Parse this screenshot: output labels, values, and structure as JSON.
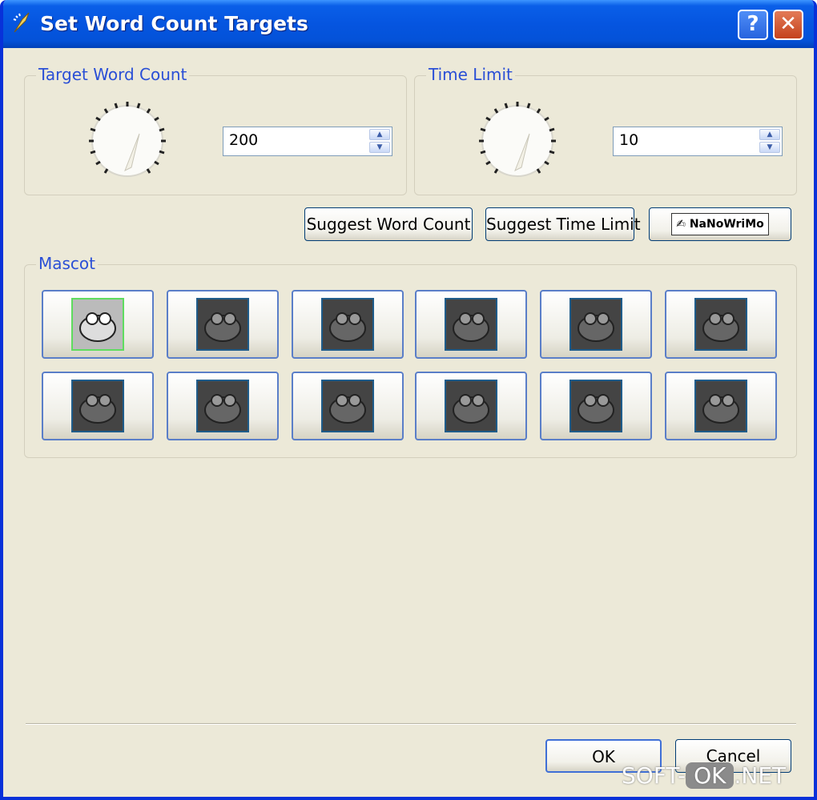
{
  "window": {
    "title": "Set Word Count Targets",
    "help_label": "?",
    "close_label": "✕",
    "title_color": "#0555e0",
    "accent_color": "#2a4fd6"
  },
  "word_count": {
    "group_label": "Target Word Count",
    "value": "200"
  },
  "time_limit": {
    "group_label": "Time Limit",
    "value": "10"
  },
  "actions": {
    "suggest_word_count": "Suggest Word Count",
    "suggest_time_limit": "Suggest Time Limit",
    "nanowrimo": "NaNoWriMo"
  },
  "mascot": {
    "group_label": "Mascot",
    "selected_index": 0,
    "count": 12
  },
  "footer": {
    "ok": "OK",
    "cancel": "Cancel"
  },
  "watermark": {
    "prefix": "SOFT-",
    "box": "OK",
    "suffix": ".NET"
  }
}
